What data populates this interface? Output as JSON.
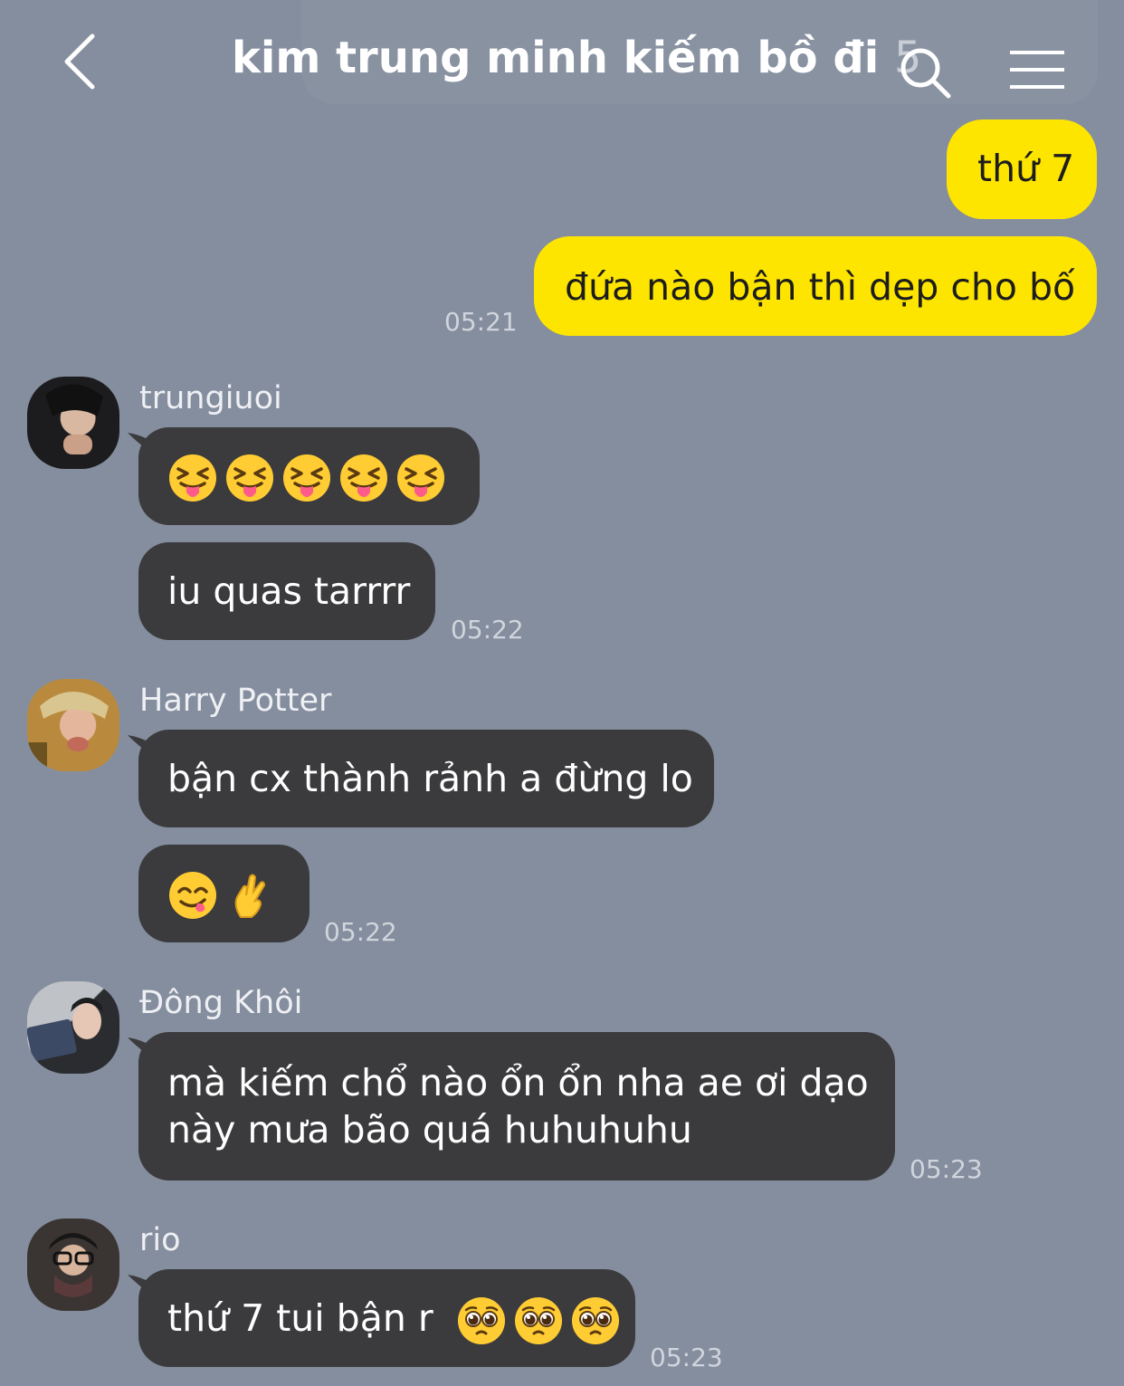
{
  "header": {
    "title": "kim trung minh kiếm bồ đi",
    "member_count": "5"
  },
  "messages": [
    {
      "from": "me",
      "text": "thứ 7"
    },
    {
      "from": "me",
      "text": "đứa nào bận thì dẹp cho bố",
      "time": "05:21"
    },
    {
      "sender": "trungiuoi",
      "emojis": [
        "squinting-tongue-emoji",
        "squinting-tongue-emoji",
        "squinting-tongue-emoji",
        "squinting-tongue-emoji",
        "squinting-tongue-emoji"
      ]
    },
    {
      "sender": "trungiuoi",
      "text": "iu quas tarrrr",
      "time": "05:22"
    },
    {
      "sender": "Harry Potter",
      "text": "bận cx thành rảnh a đừng lo"
    },
    {
      "sender": "Harry Potter",
      "emojis": [
        "yum-face-emoji",
        "crossed-fingers-emoji"
      ],
      "time": "05:22"
    },
    {
      "sender": "Đông Khôi",
      "text_line1": "mà kiếm chổ nào ổn ổn nha ae ơi dạo",
      "text_line2": "này mưa bão quá huhuhuhu",
      "time": "05:23"
    },
    {
      "sender": "rio",
      "text": "thứ 7 tui bận r",
      "emojis": [
        "pleading-face-emoji",
        "pleading-face-emoji",
        "pleading-face-emoji"
      ],
      "time": "05:23"
    }
  ],
  "colors": {
    "background": "#858e9e",
    "my_bubble": "#fee500",
    "other_bubble": "#3b3b3d"
  }
}
